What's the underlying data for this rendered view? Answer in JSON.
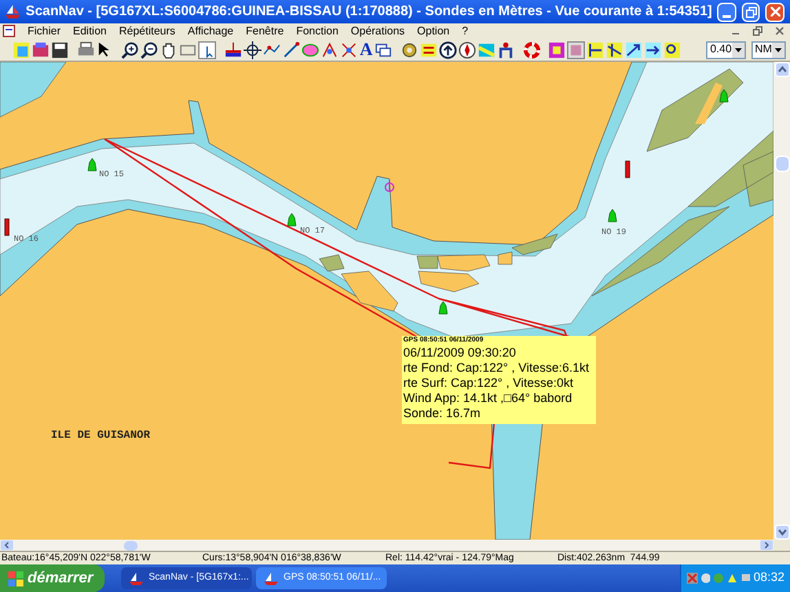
{
  "window": {
    "title": "ScanNav - [5G167XL:S6004786:GUINEA-BISSAU (1:170888) - Sondes en  Mètres  - Vue courante à 1:54351]"
  },
  "menu": [
    "Fichier",
    "Edition",
    "Répétiteurs",
    "Affichage",
    "Fenêtre",
    "Fonction",
    "Opérations",
    "Option",
    "?"
  ],
  "toolbar": {
    "text_tool": "A",
    "scale_select": "0.40",
    "unit_select": "NM"
  },
  "map": {
    "labels": [
      {
        "text": "ILE DE GUISANOR",
        "kind": "place"
      },
      {
        "text": "NO 15",
        "kind": "buoy"
      },
      {
        "text": "NO 17",
        "kind": "buoy"
      },
      {
        "text": "NO 19",
        "kind": "buoy"
      },
      {
        "text": "NO 16",
        "kind": "buoy"
      }
    ]
  },
  "tooltip": {
    "title": "GPS 08:50:51 06/11/2009",
    "lines": [
      "06/11/2009 09:30:20",
      "rte Fond: Cap:122° , Vitesse:6.1kt",
      "rte Surf: Cap:122° , Vitesse:0kt",
      "Wind App: 14.1kt ,□64° babord",
      "Sonde: 16.7m"
    ]
  },
  "status_bar": [
    "Bateau:16°45,209'N 022°58,781'W",
    "Curs:13°58,904'N 016°38,836'W",
    "Rel: 114.42°vrai - 124.79°Mag",
    "Dist:402.263nm  744.99"
  ],
  "taskbar": {
    "start": "démarrer",
    "tasks": [
      {
        "label": "ScanNav - [5G167x1:...",
        "selected": true
      },
      {
        "label": "GPS 08:50:51 06/11/...",
        "selected": false
      }
    ],
    "clock": "08:32"
  }
}
